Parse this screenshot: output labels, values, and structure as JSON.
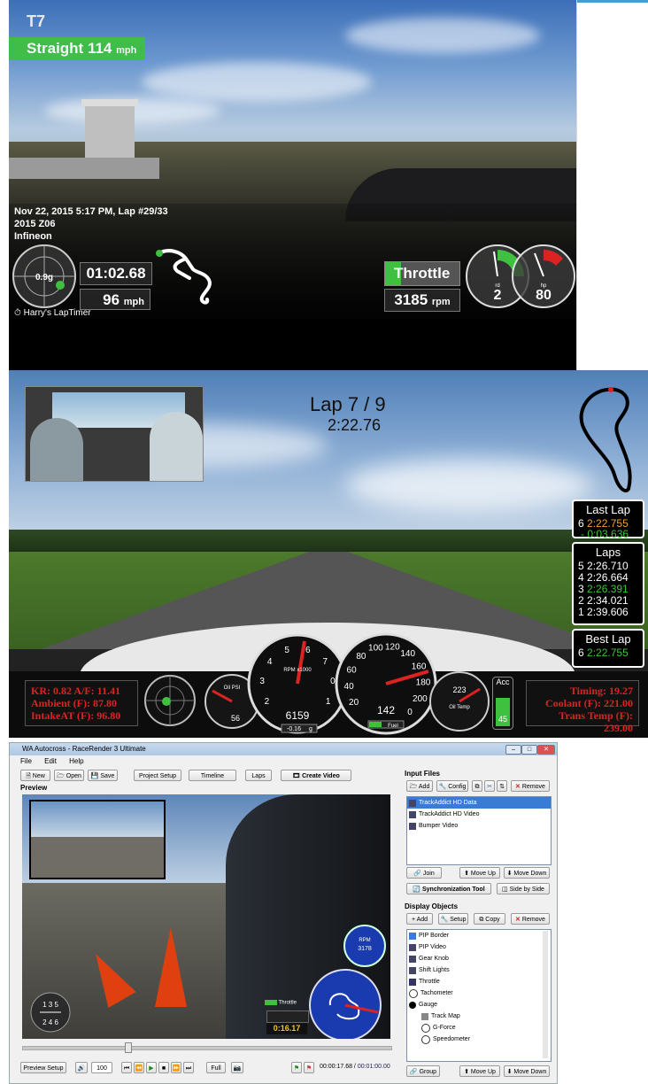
{
  "panel1": {
    "corner": "T7",
    "straight_label": "Straight 114",
    "straight_unit": "mph",
    "meta_line1": "Nov 22, 2015 5:17 PM, Lap #29/33",
    "meta_line2": "2015 Z06",
    "meta_line3": "Infineon",
    "gforce": "0.9g",
    "lap_time": "01:02.68",
    "speed": "96",
    "speed_unit": "mph",
    "throttle_label": "Throttle",
    "rpm": "3185",
    "rpm_unit": "rpm",
    "gear": "2",
    "gear_label": "rd",
    "power": "80",
    "power_label": "hp",
    "watermark": "Harry's LapTimer",
    "throttle_fraction": 0.2
  },
  "panel2": {
    "lap_title": "Lap  7 / 9",
    "lap_time": "2:22.76",
    "last_lap_title": "Last Lap",
    "last_lap_num": "6",
    "last_lap_time": "2:22.755",
    "last_lap_delta": "- 0:03.636",
    "laps_title": "Laps",
    "laps": [
      {
        "n": "5",
        "t": "2:26.710",
        "best": false
      },
      {
        "n": "4",
        "t": "2:26.664",
        "best": false
      },
      {
        "n": "3",
        "t": "2:26.391",
        "best": true
      },
      {
        "n": "2",
        "t": "2:34.021",
        "best": false
      },
      {
        "n": "1",
        "t": "2:39.606",
        "best": false
      }
    ],
    "best_lap_title": "Best Lap",
    "best_lap_num": "6",
    "best_lap_time": "2:22.755",
    "left_stats": [
      "KR: 0.82   A/F: 11.41",
      "Ambient (F):   87.80",
      "IntakeAT (F):  96.80"
    ],
    "right_stats": [
      "Timing:   19.27",
      "Coolant (F):  221.00",
      "Trans Temp (F): 239.00"
    ],
    "oilpsi_label": "Oil PSI",
    "oilpsi_value": "56",
    "tacho_label": "RPM x1000",
    "tacho_value": "6159",
    "tacho_g": "-0.16",
    "tacho_g_unit": "g",
    "speedo_value": "142",
    "fuel_label": "Fuel",
    "oiltemp_label": "Oil Temp",
    "oiltemp_value": "223",
    "acc_label": "Acc",
    "acc_value": "45",
    "tacho_ticks": [
      "2",
      "3",
      "4",
      "5",
      "6",
      "7",
      "0",
      "1"
    ],
    "speedo_ticks": [
      "20",
      "40",
      "60",
      "80",
      "100",
      "120",
      "140",
      "160",
      "180",
      "200",
      "0"
    ]
  },
  "panel3": {
    "window_title": "WA Autocross - RaceRender 3 Ultimate",
    "menu": [
      "File",
      "Edit",
      "Help"
    ],
    "toolbar": [
      "New",
      "Open",
      "Save",
      "Project Setup",
      "Timeline",
      "Laps",
      "Create Video"
    ],
    "preview_label": "Preview",
    "input_files_label": "Input Files",
    "input_buttons": [
      "Add",
      "Config",
      "Remove"
    ],
    "input_files": [
      "TrackAddict HD Data",
      "TrackAddict HD Video",
      "Bumper Video"
    ],
    "join_label": "Join",
    "move_up": "Move Up",
    "move_down": "Move Down",
    "sync_tool": "Synchronization Tool",
    "side_by_side": "Side by Side",
    "display_objects_label": "Display Objects",
    "display_buttons": [
      "Add",
      "Setup",
      "Copy",
      "Remove"
    ],
    "display_objects": [
      "PIP Border",
      "PIP Video",
      "Gear Knob",
      "Shift Lights",
      "Throttle",
      "Tachometer",
      "Gauge",
      "Track Map",
      "G-Force",
      "Speedometer"
    ],
    "group_label": "Group",
    "preview_setup": "Preview Setup",
    "zoom": "100",
    "full_label": "Full",
    "time_current": "00:00:17.68",
    "time_total": "00:01:00.00",
    "overlay_time": "0:16.17",
    "overlay_rpm": "3178",
    "overlay_rpm_label": "RPM",
    "overlay_throttle": "Throttle",
    "gear_pattern_top": "1 3 5",
    "gear_pattern_bottom": "2 4 6"
  }
}
